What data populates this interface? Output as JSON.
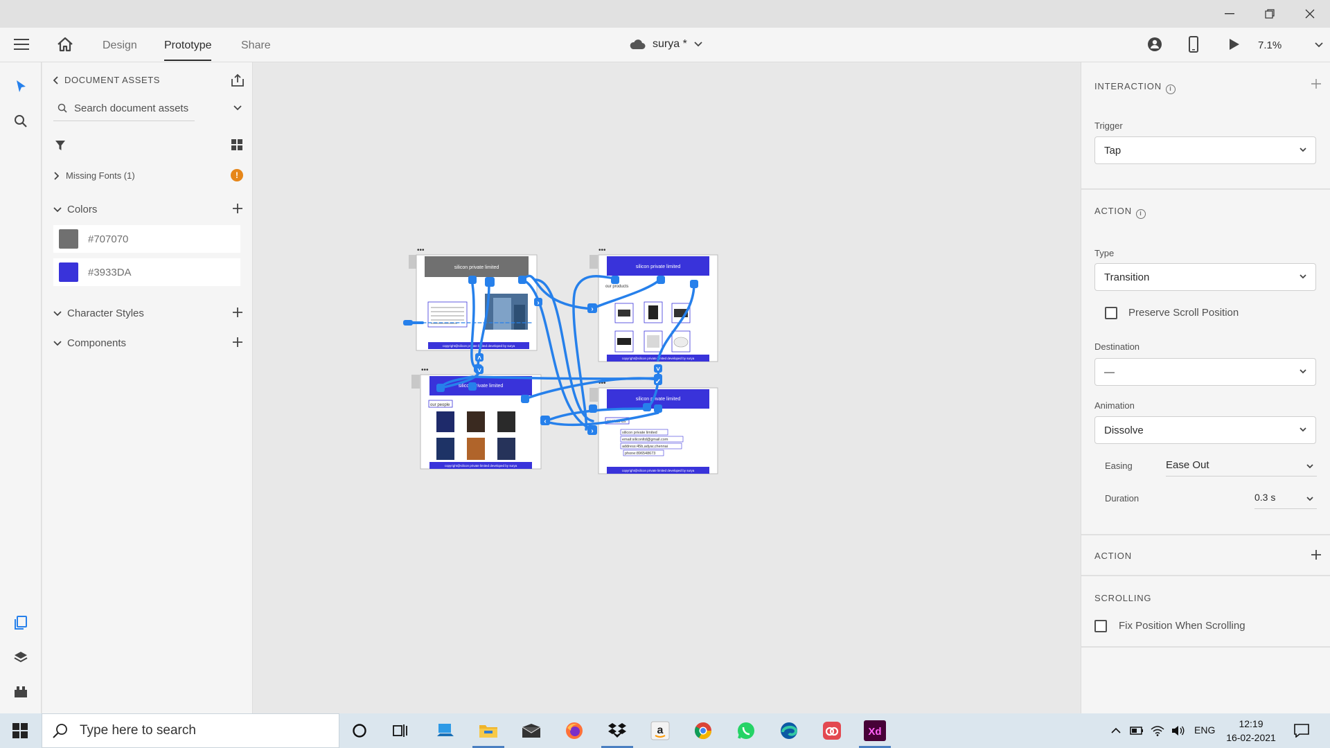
{
  "window": {
    "minimize": "—",
    "restore": "❐",
    "close": "✕"
  },
  "header": {
    "tabs": [
      {
        "label": "Design"
      },
      {
        "label": "Prototype"
      },
      {
        "label": "Share"
      }
    ],
    "doc_name": "surya *",
    "zoom": "7.1%"
  },
  "assets": {
    "title": "DOCUMENT ASSETS",
    "search_placeholder": "Search document assets",
    "missing_fonts": "Missing Fonts (1)",
    "colors_title": "Colors",
    "colors": [
      {
        "label": "#707070",
        "hex": "#707070"
      },
      {
        "label": "#3933DA",
        "hex": "#3933DA"
      }
    ],
    "character_styles": "Character Styles",
    "components": "Components"
  },
  "canvas": {
    "artboards": [
      {
        "header": "silicon private limited",
        "footer": "copyright@silicon private limited developed by surya"
      },
      {
        "header": "silicon private limited",
        "subtitle": "our products",
        "footer": "copyright@silicon private limited developed by surya"
      },
      {
        "header": "silicon private limited",
        "subtitle": "our people",
        "footer": "copyright@silicon private limited developed by surya"
      },
      {
        "header": "silicon private limited",
        "subtitle": "contact us",
        "lines": [
          "silicon private limited",
          "email:siliconltd@gmail.com",
          "address:45b,adyar,chennai",
          "phone:896548673"
        ],
        "footer": "copyright@silicon private limited developed by surya"
      }
    ]
  },
  "interaction": {
    "title": "INTERACTION",
    "trigger_label": "Trigger",
    "trigger_value": "Tap",
    "action_title": "ACTION",
    "type_label": "Type",
    "type_value": "Transition",
    "preserve_scroll": "Preserve Scroll Position",
    "destination_label": "Destination",
    "destination_value": "—",
    "animation_label": "Animation",
    "animation_value": "Dissolve",
    "easing_label": "Easing",
    "easing_value": "Ease Out",
    "duration_label": "Duration",
    "duration_value": "0.3 s",
    "action2_title": "ACTION",
    "scrolling_title": "SCROLLING",
    "fix_position": "Fix Position When Scrolling"
  },
  "taskbar": {
    "search_placeholder": "Type here to search",
    "lang": "ENG",
    "time": "12:19",
    "date": "16-02-2021",
    "apps": [
      "cortana-icon",
      "task-view-icon",
      "computer-icon",
      "file-explorer-icon",
      "mail-icon",
      "firefox-icon",
      "dropbox-icon",
      "amazon-icon",
      "chrome-icon",
      "whatsapp-icon",
      "edge-icon",
      "creative-cloud-icon",
      "adobe-xd-icon"
    ]
  },
  "colors": {
    "wire": "#2680eb",
    "artboard_blue": "#3933da",
    "artboard_grey": "#707070"
  }
}
